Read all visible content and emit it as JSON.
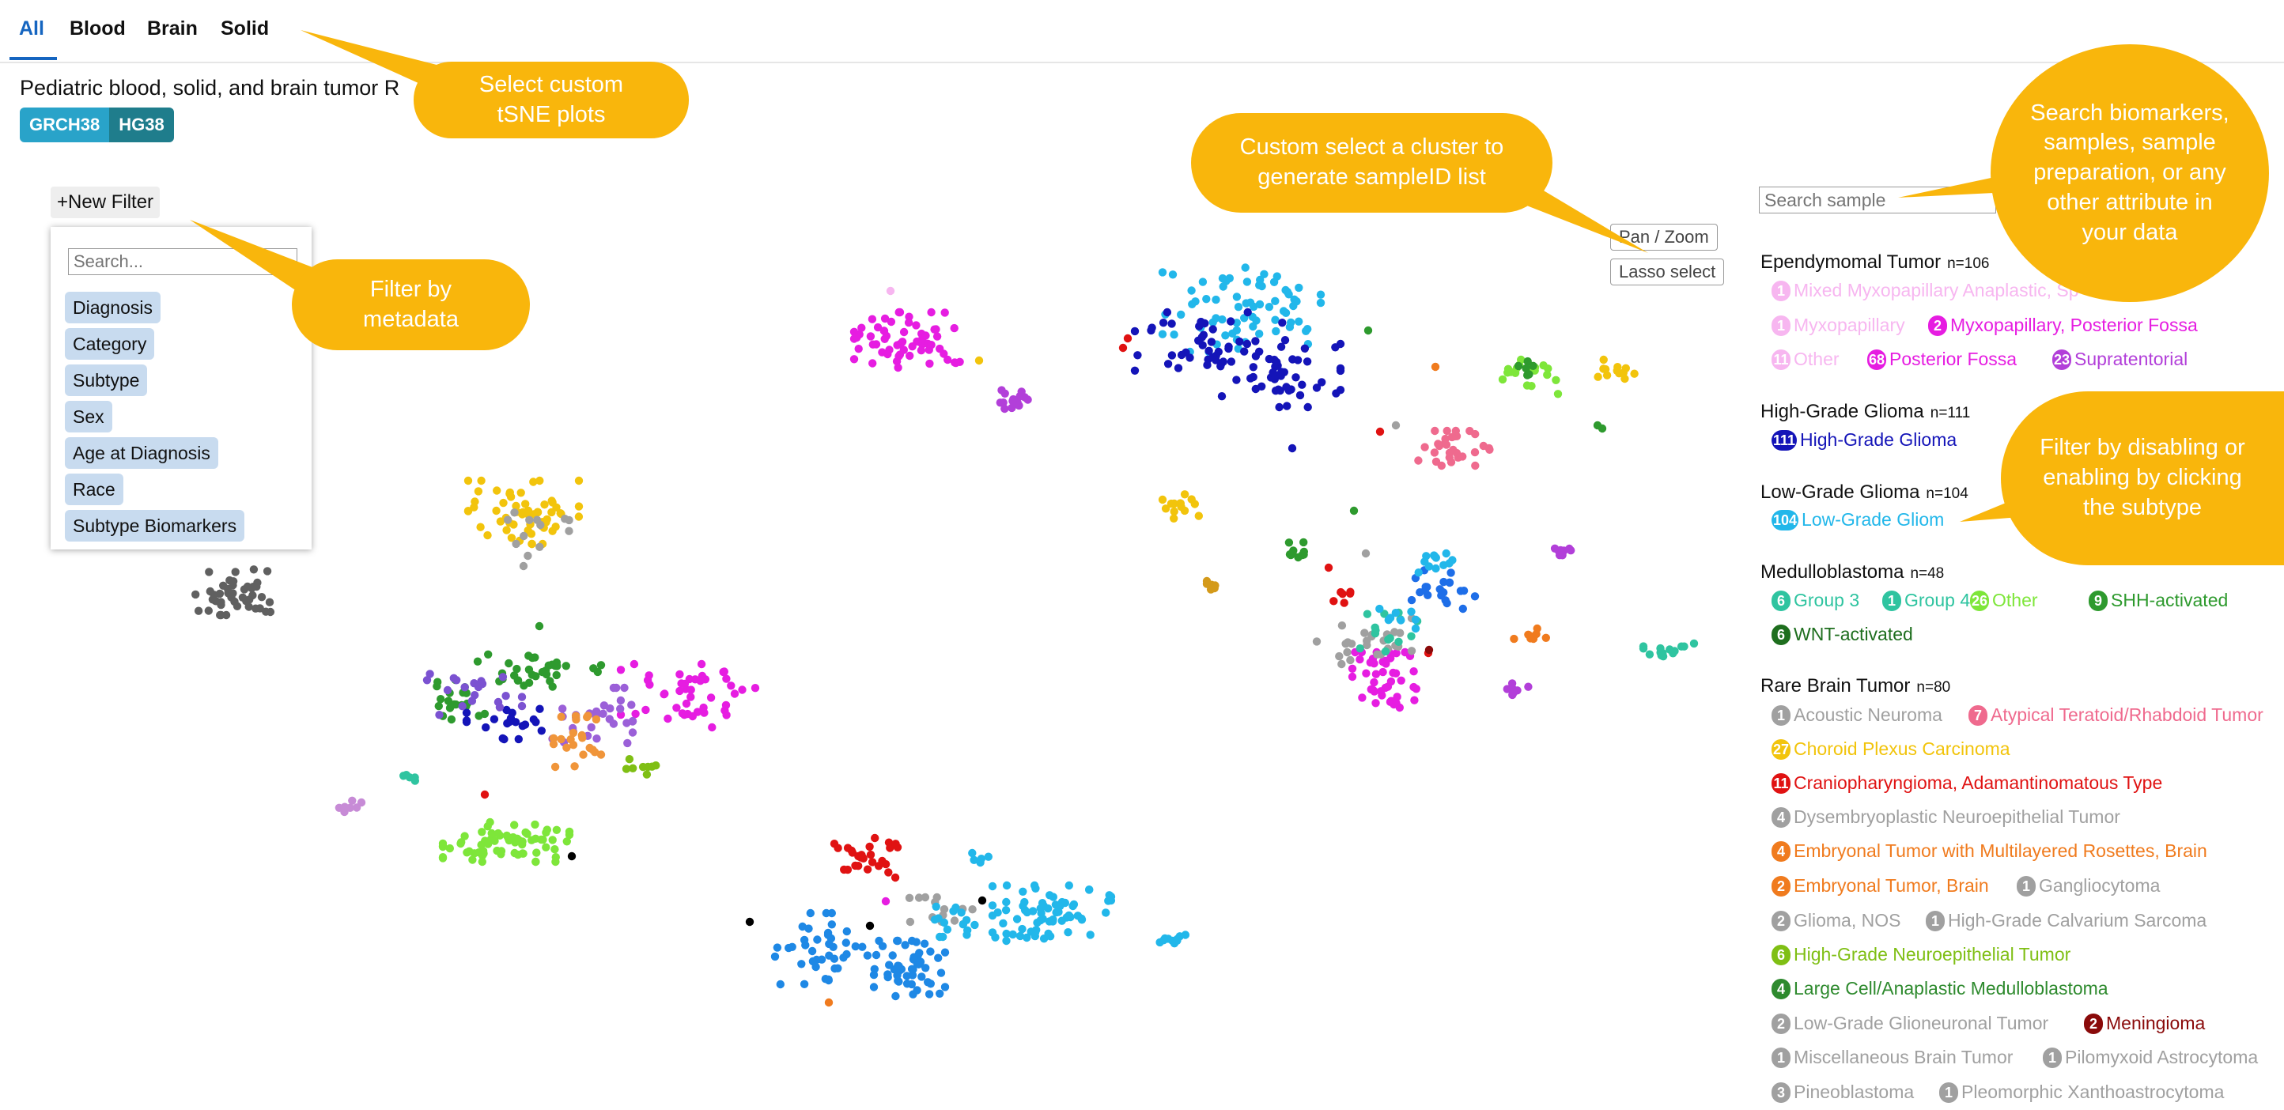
{
  "tabs": [
    "All",
    "Blood",
    "Brain",
    "Solid"
  ],
  "subtitle": "Pediatric blood, solid, and brain tumor R",
  "genome": {
    "left": "GRCH38",
    "right": "HG38"
  },
  "filter": {
    "new_filter_label": "+New Filter",
    "search_placeholder": "Search...",
    "options": [
      "Diagnosis",
      "Category",
      "Subtype",
      "Sex",
      "Age at Diagnosis",
      "Race",
      "Subtype Biomarkers"
    ]
  },
  "plot_controls": {
    "pan_zoom": "Pan / Zoom",
    "lasso": "Lasso select"
  },
  "legend": {
    "search_placeholder": "Search sample",
    "groups": [
      {
        "title": "Ependymomal Tumor",
        "n": "n=106"
      },
      {
        "title": "High-Grade Glioma",
        "n": "n=111"
      },
      {
        "title": "Low-Grade Glioma",
        "n": "n=104"
      },
      {
        "title": "Medulloblastoma",
        "n": "n=48"
      },
      {
        "title": "Rare Brain Tumor",
        "n": "n=80"
      }
    ],
    "items": [
      {
        "count": "1",
        "label": "Mixed Myxopapillary Anaplastic, Sp",
        "color": "#f7b6f0"
      },
      {
        "count": "1",
        "label": "Myxopapillary",
        "color": "#f7b6f0"
      },
      {
        "count": "2",
        "label": "Myxopapillary, Posterior Fossa",
        "color": "#e61de1"
      },
      {
        "count": "11",
        "label": "Other",
        "color": "#f7b6f0"
      },
      {
        "count": "68",
        "label": "Posterior Fossa",
        "color": "#e61de1"
      },
      {
        "count": "23",
        "label": "Supratentorial",
        "color": "#b23fd9"
      },
      {
        "count": "111",
        "label": "High-Grade Glioma",
        "color": "#1414b8"
      },
      {
        "count": "104",
        "label": "Low-Grade Gliom",
        "color": "#22b7ea"
      },
      {
        "count": "6",
        "label": "Group 3",
        "color": "#2fc4a0"
      },
      {
        "count": "1",
        "label": "Group 4",
        "color": "#2fc4a0"
      },
      {
        "count": "26",
        "label": "Other",
        "color": "#7ee63a"
      },
      {
        "count": "9",
        "label": "SHH-activated",
        "color": "#2e9a2e"
      },
      {
        "count": "6",
        "label": "WNT-activated",
        "color": "#1e6e1e"
      },
      {
        "count": "1",
        "label": "Acoustic Neuroma",
        "color": "#a0a0a0"
      },
      {
        "count": "7",
        "label": "Atypical Teratoid/Rhabdoid Tumor",
        "color": "#ef6a8e"
      },
      {
        "count": "27",
        "label": "Choroid Plexus Carcinoma",
        "color": "#f2c40c"
      },
      {
        "count": "11",
        "label": "Craniopharyngioma, Adamantinomatous Type",
        "color": "#e01212"
      },
      {
        "count": "4",
        "label": "Dysembryoplastic Neuroepithelial Tumor",
        "color": "#a0a0a0"
      },
      {
        "count": "4",
        "label": "Embryonal Tumor with Multilayered Rosettes, Brain",
        "color": "#f07b1e"
      },
      {
        "count": "2",
        "label": "Embryonal Tumor, Brain",
        "color": "#f07b1e"
      },
      {
        "count": "1",
        "label": "Gangliocytoma",
        "color": "#a0a0a0"
      },
      {
        "count": "2",
        "label": "Glioma, NOS",
        "color": "#a0a0a0"
      },
      {
        "count": "1",
        "label": "High-Grade Calvarium Sarcoma",
        "color": "#a0a0a0"
      },
      {
        "count": "6",
        "label": "High-Grade Neuroepithelial Tumor",
        "color": "#7fbf14"
      },
      {
        "count": "4",
        "label": "Large Cell/Anaplastic Medulloblastoma",
        "color": "#2e8a2e"
      },
      {
        "count": "2",
        "label": "Low-Grade Glioneuronal Tumor",
        "color": "#a0a0a0"
      },
      {
        "count": "2",
        "label": "Meningioma",
        "color": "#8a0a0a"
      },
      {
        "count": "1",
        "label": "Miscellaneous Brain Tumor",
        "color": "#a0a0a0"
      },
      {
        "count": "1",
        "label": "Pilomyxoid Astrocytoma",
        "color": "#a0a0a0"
      },
      {
        "count": "3",
        "label": "Pineoblastoma",
        "color": "#a0a0a0"
      },
      {
        "count": "1",
        "label": "Pleomorphic Xanthoastrocytoma",
        "color": "#a0a0a0"
      }
    ]
  },
  "callouts": {
    "tsne": "Select custom\ntSNE plots",
    "filter": "Filter by\nmetadata",
    "cluster": "Custom select a cluster to\ngenerate sampleID list",
    "search": "Search biomarkers,\nsamples, sample\npreparation, or any\nother attribute in\nyour data",
    "disable": "Filter by disabling or\nenabling by clicking\nthe subtype"
  },
  "colors": {
    "active_tab": "#1565c0",
    "callout": "#f9b60c",
    "chip": "#c8dbef"
  },
  "clusters": [
    {
      "color": "#e61de1",
      "cx": 1150,
      "cy": 430,
      "rx": 70,
      "ry": 35,
      "n": 60
    },
    {
      "color": "#b23fd9",
      "cx": 1278,
      "cy": 503,
      "rx": 22,
      "ry": 14,
      "n": 14
    },
    {
      "color": "#22b7ea",
      "cx": 1570,
      "cy": 390,
      "rx": 100,
      "ry": 55,
      "n": 70
    },
    {
      "color": "#1414b8",
      "cx": 1530,
      "cy": 440,
      "rx": 95,
      "ry": 45,
      "n": 45
    },
    {
      "color": "#1414b8",
      "cx": 1620,
      "cy": 475,
      "rx": 75,
      "ry": 40,
      "n": 45
    },
    {
      "color": "#7ee63a",
      "cx": 1935,
      "cy": 477,
      "rx": 35,
      "ry": 22,
      "n": 18
    },
    {
      "color": "#2e9a2e",
      "cx": 1935,
      "cy": 465,
      "rx": 15,
      "ry": 10,
      "n": 6
    },
    {
      "color": "#f2c40c",
      "cx": 2042,
      "cy": 467,
      "rx": 25,
      "ry": 12,
      "n": 12
    },
    {
      "color": "#ef6a8e",
      "cx": 1840,
      "cy": 567,
      "rx": 48,
      "ry": 22,
      "n": 30
    },
    {
      "color": "#f2c40c",
      "cx": 662,
      "cy": 648,
      "rx": 70,
      "ry": 40,
      "n": 60
    },
    {
      "color": "#a0a0a0",
      "cx": 682,
      "cy": 668,
      "rx": 60,
      "ry": 35,
      "n": 12
    },
    {
      "color": "#606060",
      "cx": 293,
      "cy": 748,
      "rx": 55,
      "ry": 30,
      "n": 45
    },
    {
      "color": "#f2c40c",
      "cx": 1495,
      "cy": 640,
      "rx": 25,
      "ry": 16,
      "n": 14
    },
    {
      "color": "#2e9a2e",
      "cx": 1638,
      "cy": 693,
      "rx": 20,
      "ry": 12,
      "n": 10
    },
    {
      "color": "#d49a1a",
      "cx": 1538,
      "cy": 743,
      "rx": 12,
      "ry": 8,
      "n": 6
    },
    {
      "color": "#1e6ee8",
      "cx": 1825,
      "cy": 745,
      "rx": 40,
      "ry": 25,
      "n": 22
    },
    {
      "color": "#22b7ea",
      "cx": 1815,
      "cy": 715,
      "rx": 25,
      "ry": 15,
      "n": 12
    },
    {
      "color": "#e61de1",
      "cx": 1755,
      "cy": 860,
      "rx": 45,
      "ry": 35,
      "n": 45
    },
    {
      "color": "#a0a0a0",
      "cx": 1725,
      "cy": 810,
      "rx": 60,
      "ry": 30,
      "n": 25
    },
    {
      "color": "#2fc4a0",
      "cx": 1755,
      "cy": 800,
      "rx": 40,
      "ry": 25,
      "n": 14
    },
    {
      "color": "#22b7ea",
      "cx": 1760,
      "cy": 780,
      "rx": 30,
      "ry": 15,
      "n": 8
    },
    {
      "color": "#e01212",
      "cx": 1700,
      "cy": 755,
      "rx": 25,
      "ry": 10,
      "n": 6
    },
    {
      "color": "#b23fd9",
      "cx": 1970,
      "cy": 695,
      "rx": 20,
      "ry": 8,
      "n": 8
    },
    {
      "color": "#2fc4a0",
      "cx": 2110,
      "cy": 820,
      "rx": 32,
      "ry": 12,
      "n": 14
    },
    {
      "color": "#f07b1e",
      "cx": 1935,
      "cy": 803,
      "rx": 22,
      "ry": 8,
      "n": 8
    },
    {
      "color": "#b23fd9",
      "cx": 1915,
      "cy": 872,
      "rx": 18,
      "ry": 14,
      "n": 9
    },
    {
      "color": "#2e9a2e",
      "cx": 680,
      "cy": 850,
      "rx": 80,
      "ry": 25,
      "n": 35
    },
    {
      "color": "#2e9a2e",
      "cx": 580,
      "cy": 890,
      "rx": 40,
      "ry": 30,
      "n": 20
    },
    {
      "color": "#1414b8",
      "cx": 640,
      "cy": 910,
      "rx": 50,
      "ry": 25,
      "n": 20
    },
    {
      "color": "#7b52d1",
      "cx": 600,
      "cy": 880,
      "rx": 60,
      "ry": 30,
      "n": 20
    },
    {
      "color": "#e61de1",
      "cx": 870,
      "cy": 880,
      "rx": 85,
      "ry": 40,
      "n": 45
    },
    {
      "color": "#9b60d8",
      "cx": 740,
      "cy": 905,
      "rx": 60,
      "ry": 35,
      "n": 30
    },
    {
      "color": "#f0953a",
      "cx": 730,
      "cy": 935,
      "rx": 30,
      "ry": 35,
      "n": 22
    },
    {
      "color": "#7fbf14",
      "cx": 810,
      "cy": 968,
      "rx": 20,
      "ry": 15,
      "n": 8
    },
    {
      "color": "#7ee63a",
      "cx": 640,
      "cy": 1065,
      "rx": 80,
      "ry": 25,
      "n": 70
    },
    {
      "color": "#2fc4a0",
      "cx": 515,
      "cy": 982,
      "rx": 18,
      "ry": 6,
      "n": 5
    },
    {
      "color": "#c78bd6",
      "cx": 445,
      "cy": 1020,
      "rx": 20,
      "ry": 8,
      "n": 8
    },
    {
      "color": "#e01212",
      "cx": 1095,
      "cy": 1085,
      "rx": 40,
      "ry": 25,
      "n": 28
    },
    {
      "color": "#1e88e5",
      "cx": 1150,
      "cy": 1225,
      "rx": 45,
      "ry": 35,
      "n": 50
    },
    {
      "color": "#1e88e5",
      "cx": 1040,
      "cy": 1200,
      "rx": 60,
      "ry": 45,
      "n": 40
    },
    {
      "color": "#22b7ea",
      "cx": 1330,
      "cy": 1155,
      "rx": 75,
      "ry": 35,
      "n": 70
    },
    {
      "color": "#a0a0a0",
      "cx": 1190,
      "cy": 1155,
      "rx": 40,
      "ry": 20,
      "n": 15
    },
    {
      "color": "#22b7ea",
      "cx": 1200,
      "cy": 1165,
      "rx": 35,
      "ry": 20,
      "n": 15
    },
    {
      "color": "#22b7ea",
      "cx": 1488,
      "cy": 1188,
      "rx": 22,
      "ry": 6,
      "n": 10
    },
    {
      "color": "#22b7ea",
      "cx": 1242,
      "cy": 1085,
      "rx": 18,
      "ry": 6,
      "n": 5
    }
  ],
  "scatter": [
    {
      "color": "#e01212",
      "x": 1426,
      "y": 428
    },
    {
      "color": "#e01212",
      "x": 1420,
      "y": 440
    },
    {
      "color": "#2e9a2e",
      "x": 1730,
      "y": 418
    },
    {
      "color": "#2e9a2e",
      "x": 2020,
      "y": 538
    },
    {
      "color": "#2e9a2e",
      "x": 2026,
      "y": 542
    },
    {
      "color": "#f07b1e",
      "x": 1815,
      "y": 464
    },
    {
      "color": "#e01212",
      "x": 1745,
      "y": 546
    },
    {
      "color": "#a0a0a0",
      "x": 1765,
      "y": 538
    },
    {
      "color": "#1414b8",
      "x": 1634,
      "y": 567
    },
    {
      "color": "#f7b6f0",
      "x": 1126,
      "y": 368
    },
    {
      "color": "#a0a0a0",
      "x": 662,
      "y": 716
    },
    {
      "color": "#e01212",
      "x": 613,
      "y": 1005
    },
    {
      "color": "#2e9a2e",
      "x": 682,
      "y": 792
    },
    {
      "color": "#000000",
      "x": 723,
      "y": 1083
    },
    {
      "color": "#000000",
      "x": 948,
      "y": 1166
    },
    {
      "color": "#000000",
      "x": 1100,
      "y": 1171
    },
    {
      "color": "#000000",
      "x": 1242,
      "y": 1139
    },
    {
      "color": "#f07b1e",
      "x": 1048,
      "y": 1268
    },
    {
      "color": "#e01212",
      "x": 1680,
      "y": 718
    },
    {
      "color": "#a0a0a0",
      "x": 1727,
      "y": 700
    },
    {
      "color": "#e01212",
      "x": 1806,
      "y": 826
    },
    {
      "color": "#2e9a2e",
      "x": 1712,
      "y": 646
    },
    {
      "color": "#8a0a0a",
      "x": 1807,
      "y": 822
    },
    {
      "color": "#f2c40c",
      "x": 1238,
      "y": 456
    },
    {
      "color": "#e61de1",
      "x": 1120,
      "y": 1140
    },
    {
      "color": "#1e88e5",
      "x": 1108,
      "y": 1208
    }
  ],
  "chart_data": {
    "type": "scatter",
    "title": "",
    "xlabel": "",
    "ylabel": "",
    "series": []
  }
}
